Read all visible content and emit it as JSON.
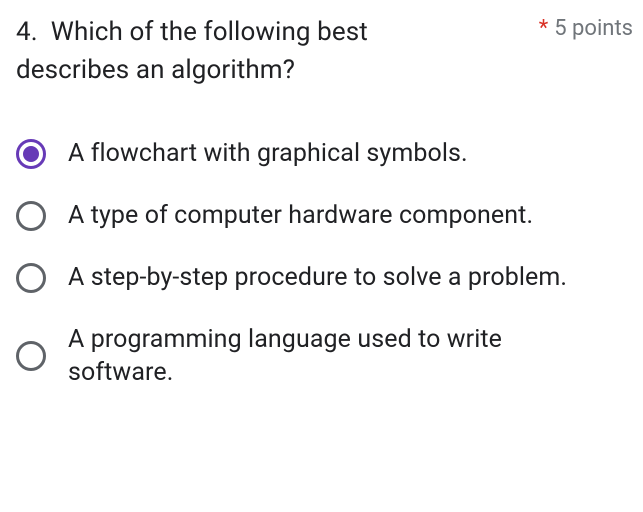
{
  "question": {
    "number": "4.",
    "text": "Which of the following best describes an algorithm?",
    "required_marker": "*",
    "points_label": "5 points"
  },
  "options": [
    {
      "label": "A flowchart with graphical symbols.",
      "selected": true
    },
    {
      "label": "A type of computer hardware component.",
      "selected": false
    },
    {
      "label": "A step-by-step procedure to solve a problem.",
      "selected": false
    },
    {
      "label": "A programming language used to write software.",
      "selected": false
    }
  ]
}
